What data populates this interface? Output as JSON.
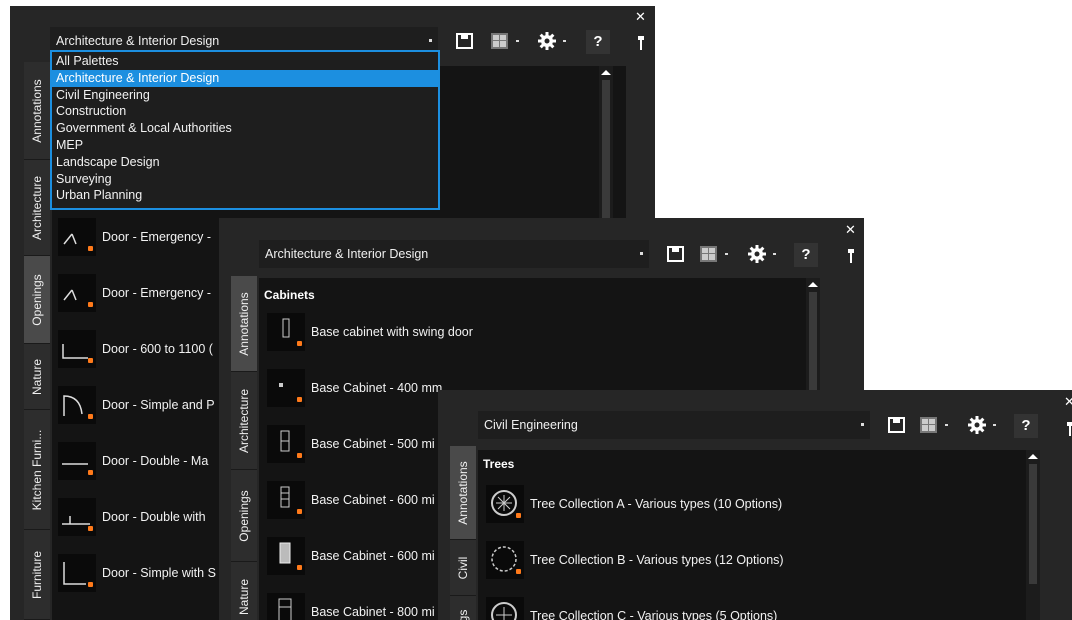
{
  "palette1": {
    "dropdown_value": "Architecture & Interior Design",
    "options": [
      "All Palettes",
      "Architecture & Interior Design",
      "Civil Engineering",
      "Construction",
      "Government & Local Authorities",
      "MEP",
      "Landscape Design",
      "Surveying",
      "Urban Planning"
    ],
    "selected_option": "Architecture & Interior Design",
    "tabs": [
      "Annotations",
      "Architecture",
      "Openings",
      "Nature",
      "Kitchen Furni...",
      "Furniture"
    ],
    "active_tab": "Openings",
    "items": [
      "Door - Emergency -",
      "Door - Emergency -",
      "Door - 600 to 1100 (",
      "Door - Simple and P",
      "Door - Double - Ma",
      "Door - Double with",
      "Door - Simple with S"
    ],
    "help_label": "?"
  },
  "palette2": {
    "dropdown_value": "Architecture & Interior Design",
    "tabs": [
      "Annotations",
      "Architecture",
      "Openings",
      "Nature"
    ],
    "active_tab": "Annotations",
    "section": "Cabinets",
    "items": [
      "Base cabinet with swing door",
      "Base Cabinet - 400 mm",
      "Base Cabinet - 500 mi",
      "Base Cabinet - 600 mi",
      "Base Cabinet - 600 mi",
      "Base Cabinet - 800 mi"
    ],
    "help_label": "?"
  },
  "palette3": {
    "dropdown_value": "Civil Engineering",
    "tabs": [
      "Annotations",
      "Civil",
      "gs"
    ],
    "active_tab": "Annotations",
    "section": "Trees",
    "items": [
      "Tree Collection A - Various types (10 Options)",
      "Tree Collection B - Various types (12 Options)",
      "Tree Collection C - Various types (5 Options)"
    ],
    "help_label": "?"
  },
  "icons": {
    "close": "close-icon",
    "pin": "pin-icon",
    "save": "save-icon",
    "view": "view-options-icon",
    "settings": "gear-icon"
  },
  "colors": {
    "accent": "#1c8fe0",
    "marker": "#ff7a1a",
    "panel": "#262626",
    "content": "#141414"
  }
}
